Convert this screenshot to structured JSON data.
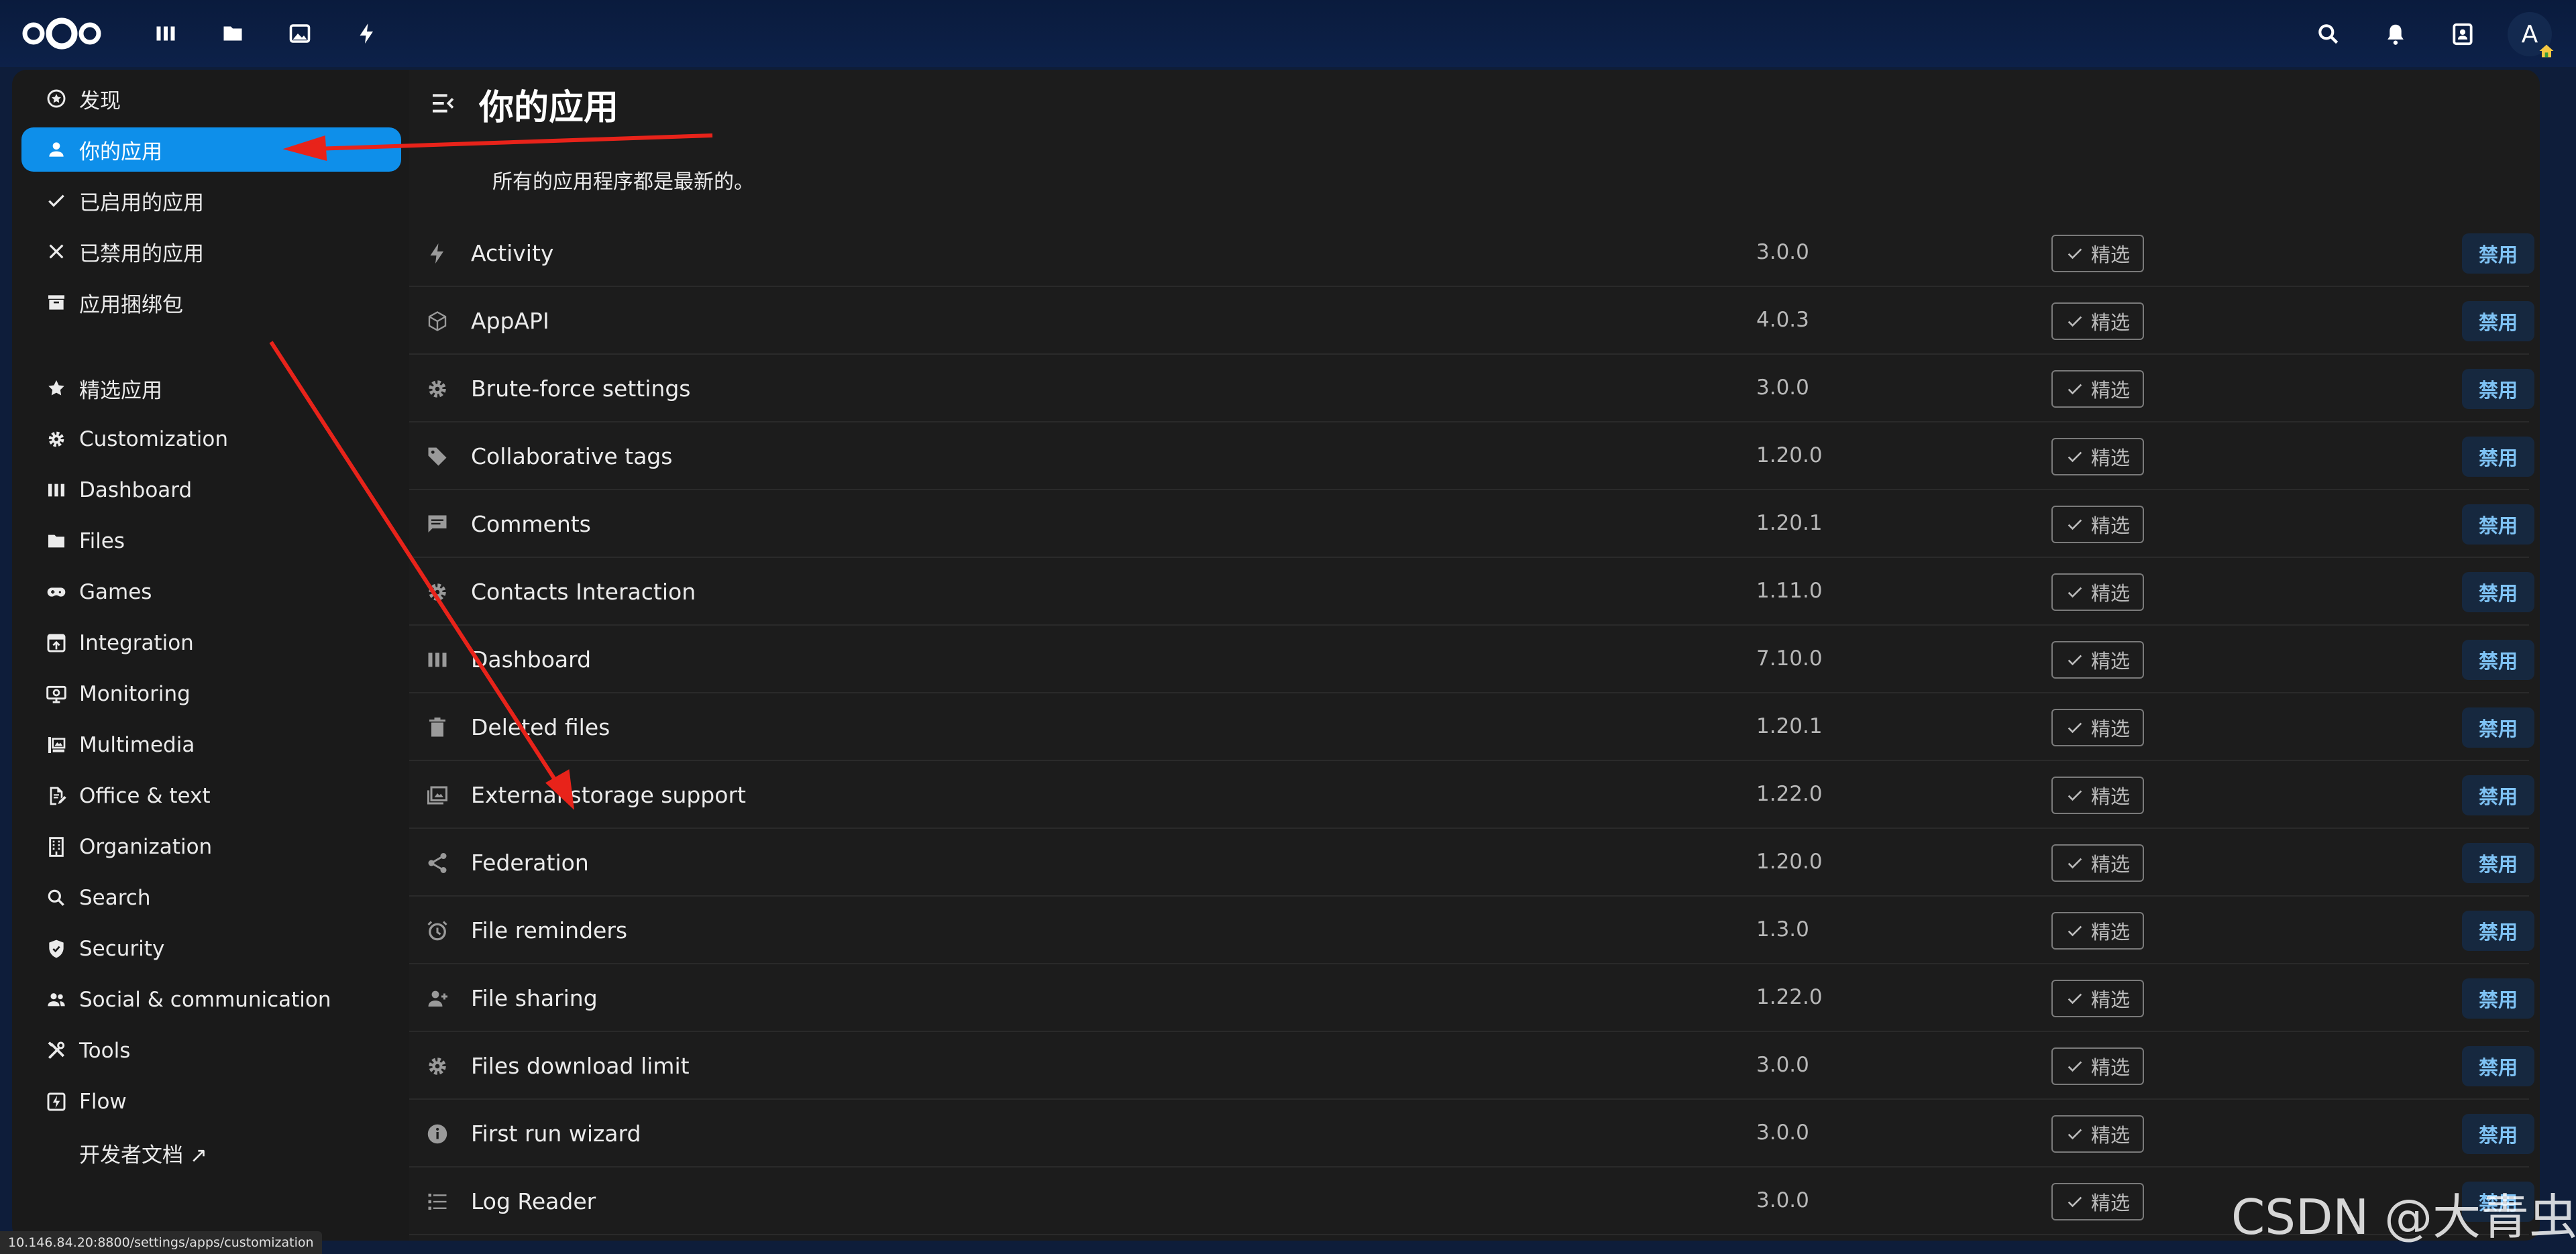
{
  "header": {
    "apps": [
      {
        "name": "dashboard",
        "icon": "dashboard-icon"
      },
      {
        "name": "files",
        "icon": "folder-icon"
      },
      {
        "name": "photos",
        "icon": "image-icon"
      },
      {
        "name": "activity",
        "icon": "lightning-icon"
      }
    ],
    "right_icons": [
      "search-icon",
      "bell-icon",
      "contacts-icon"
    ],
    "avatar_letter": "A"
  },
  "sidebar": {
    "items": [
      {
        "label": "发现",
        "icon": "star-circle-icon",
        "active": false
      },
      {
        "label": "你的应用",
        "icon": "user-icon",
        "active": true
      },
      {
        "label": "已启用的应用",
        "icon": "check-icon",
        "active": false
      },
      {
        "label": "已禁用的应用",
        "icon": "close-icon",
        "active": false
      },
      {
        "label": "应用捆绑包",
        "icon": "archive-icon",
        "active": false
      }
    ],
    "categories": [
      {
        "label": "精选应用",
        "icon": "star-icon"
      },
      {
        "label": "Customization",
        "icon": "gear-icon"
      },
      {
        "label": "Dashboard",
        "icon": "dashboard-icon"
      },
      {
        "label": "Files",
        "icon": "folder-icon"
      },
      {
        "label": "Games",
        "icon": "gamepad-icon"
      },
      {
        "label": "Integration",
        "icon": "integration-icon"
      },
      {
        "label": "Monitoring",
        "icon": "monitor-icon"
      },
      {
        "label": "Multimedia",
        "icon": "multimedia-icon"
      },
      {
        "label": "Office & text",
        "icon": "document-edit-icon"
      },
      {
        "label": "Organization",
        "icon": "building-icon"
      },
      {
        "label": "Search",
        "icon": "search-icon"
      },
      {
        "label": "Security",
        "icon": "shield-icon"
      },
      {
        "label": "Social & communication",
        "icon": "people-icon"
      },
      {
        "label": "Tools",
        "icon": "tools-icon"
      },
      {
        "label": "Flow",
        "icon": "flow-icon"
      }
    ],
    "dev_docs": "开发者文档 ↗"
  },
  "main": {
    "title": "你的应用",
    "status": "所有的应用程序都是最新的。",
    "featured_label": "精选",
    "disable_label": "禁用",
    "apps": [
      {
        "name": "Activity",
        "version": "3.0.0",
        "icon": "lightning-icon"
      },
      {
        "name": "AppAPI",
        "version": "4.0.3",
        "icon": "cube-icon"
      },
      {
        "name": "Brute-force settings",
        "version": "3.0.0",
        "icon": "gear-icon"
      },
      {
        "name": "Collaborative tags",
        "version": "1.20.0",
        "icon": "tag-icon"
      },
      {
        "name": "Comments",
        "version": "1.20.1",
        "icon": "comment-icon"
      },
      {
        "name": "Contacts Interaction",
        "version": "1.11.0",
        "icon": "gear-icon"
      },
      {
        "name": "Dashboard",
        "version": "7.10.0",
        "icon": "dashboard-icon"
      },
      {
        "name": "Deleted files",
        "version": "1.20.1",
        "icon": "trash-icon"
      },
      {
        "name": "External storage support",
        "version": "1.22.0",
        "icon": "external-storage-icon"
      },
      {
        "name": "Federation",
        "version": "1.20.0",
        "icon": "share-icon"
      },
      {
        "name": "File reminders",
        "version": "1.3.0",
        "icon": "alarm-icon"
      },
      {
        "name": "File sharing",
        "version": "1.22.0",
        "icon": "user-add-icon"
      },
      {
        "name": "Files download limit",
        "version": "3.0.0",
        "icon": "gear-icon"
      },
      {
        "name": "First run wizard",
        "version": "3.0.0",
        "icon": "info-icon"
      },
      {
        "name": "Log Reader",
        "version": "3.0.0",
        "icon": "list-icon"
      }
    ]
  },
  "statusbar_url": "10.146.84.20:8800/settings/apps/customization",
  "watermark": "CSDN @大青虫",
  "colors": {
    "accent": "#0e8fea",
    "header_bg": "#0d2149",
    "panel_bg": "#1c1c1c",
    "annotation": "#e8231a"
  }
}
